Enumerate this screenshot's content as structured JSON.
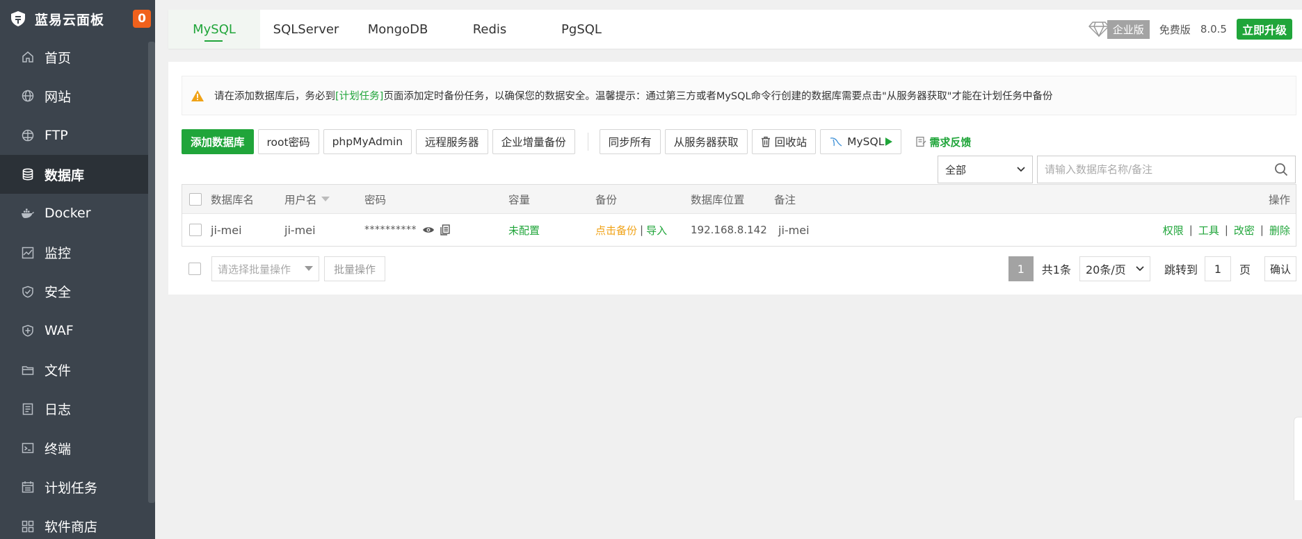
{
  "sidebar": {
    "brand": "蓝易云面板",
    "badge": "0",
    "items": [
      {
        "label": "首页",
        "icon": "home-icon"
      },
      {
        "label": "网站",
        "icon": "globe-icon"
      },
      {
        "label": "FTP",
        "icon": "ftp-globe-icon"
      },
      {
        "label": "数据库",
        "icon": "database-icon",
        "active": true
      },
      {
        "label": "Docker",
        "icon": "docker-icon"
      },
      {
        "label": "监控",
        "icon": "monitor-icon"
      },
      {
        "label": "安全",
        "icon": "shield-icon"
      },
      {
        "label": "WAF",
        "icon": "waf-shield-icon"
      },
      {
        "label": "文件",
        "icon": "folder-icon"
      },
      {
        "label": "日志",
        "icon": "log-icon"
      },
      {
        "label": "终端",
        "icon": "terminal-icon"
      },
      {
        "label": "计划任务",
        "icon": "calendar-icon"
      },
      {
        "label": "软件商店",
        "icon": "grid-icon"
      }
    ]
  },
  "tabs": [
    "MySQL",
    "SQLServer",
    "MongoDB",
    "Redis",
    "PgSQL"
  ],
  "topright": {
    "enterprise": "企业版",
    "free": "免费版",
    "version": "8.0.5",
    "upgrade": "立即升级"
  },
  "alert": {
    "pre": "请在添加数据库后，务必到",
    "link": "[计划任务]",
    "post": "页面添加定时备份任务，以确保您的数据安全。温馨提示：通过第三方或者MySQL命令行创建的数据库需要点击\"从服务器获取\"才能在计划任务中备份"
  },
  "toolbar": {
    "add_db": "添加数据库",
    "root_pwd": "root密码",
    "phpmyadmin": "phpMyAdmin",
    "remote": "远程服务器",
    "enterprise_backup": "企业增量备份",
    "sync_all": "同步所有",
    "fetch": "从服务器获取",
    "recycle": "回收站",
    "mysql": "MySQL",
    "feedback": "需求反馈"
  },
  "filter": {
    "selected": "全部"
  },
  "search": {
    "placeholder": "请输入数据库名称/备注"
  },
  "table": {
    "headers": {
      "name": "数据库名",
      "user": "用户名",
      "password": "密码",
      "capacity": "容量",
      "backup": "备份",
      "location": "数据库位置",
      "remark": "备注",
      "ops": "操作"
    },
    "rows": [
      {
        "name": "ji-mei",
        "user": "ji-mei",
        "password": "**********",
        "capacity": "未配置",
        "backup": "点击备份",
        "import": "导入",
        "location": "192.168.8.142",
        "remark": "ji-mei",
        "ops": [
          "权限",
          "工具",
          "改密",
          "删除"
        ]
      }
    ]
  },
  "footer": {
    "batch_placeholder": "请选择批量操作",
    "batch_btn": "批量操作",
    "page_current": "1",
    "total": "共1条",
    "page_size": "20条/页",
    "jump": "跳转到",
    "jump_value": "1",
    "page_unit": "页",
    "confirm": "确认"
  },
  "colors": {
    "accent": "#20a53a",
    "sidebar": "#3c444d",
    "badge": "#f0611c",
    "warning": "#f0a216"
  }
}
